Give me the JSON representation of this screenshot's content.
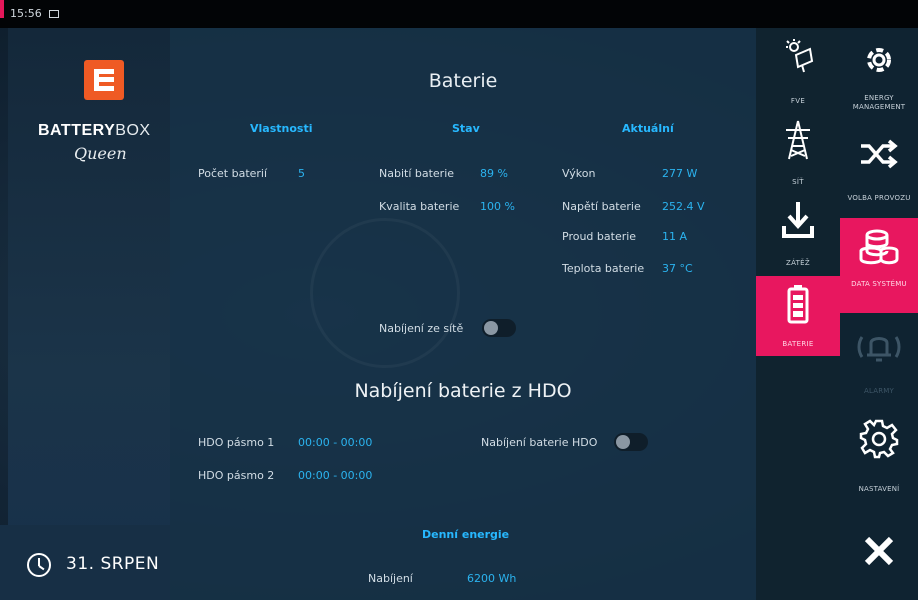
{
  "statusbar": {
    "time": "15:56"
  },
  "brand": {
    "name_bold": "BATTERY",
    "name_light": "BOX",
    "script": "Queen",
    "logo_color": "#ef5a24"
  },
  "datebar": {
    "date": "31. SRPEN"
  },
  "panel": {
    "title": "Baterie",
    "columns": {
      "props": "Vlastnosti",
      "state": "Stav",
      "current": "Aktuální"
    },
    "props": {
      "count_label": "Počet baterií",
      "count_value": "5"
    },
    "state": {
      "charged_label": "Nabití baterie",
      "charged_value": "89 %",
      "quality_label": "Kvalita baterie",
      "quality_value": "100 %"
    },
    "current": {
      "power_label": "Výkon",
      "power_value": "277 W",
      "voltage_label": "Napětí baterie",
      "voltage_value": "252.4 V",
      "current_label": "Proud baterie",
      "current_value": "11 A",
      "temp_label": "Teplota baterie",
      "temp_value": "37 °C"
    },
    "grid_charging_label": "Nabíjení ze sítě",
    "hdo_title": "Nabíjení baterie z HDO",
    "hdo1_label": "HDO pásmo 1",
    "hdo1_value": "00:00 - 00:00",
    "hdo2_label": "HDO pásmo 2",
    "hdo2_value": "00:00 - 00:00",
    "hdo_toggle_label": "Nabíjení baterie HDO",
    "daily_title": "Denní energie",
    "daily_charge_label": "Nabíjení",
    "daily_charge_value": "6200 Wh"
  },
  "devices": [
    {
      "label": "FVE",
      "icon": "solar-panel-icon"
    },
    {
      "label": "SÍŤ",
      "icon": "power-pylon-icon"
    },
    {
      "label": "ZÁTĚŽ",
      "icon": "download-icon"
    },
    {
      "label": "BATERIE",
      "icon": "battery-icon"
    }
  ],
  "menu": [
    {
      "label": "ENERGY MANAGEMENT",
      "icon": "energy-management-icon"
    },
    {
      "label": "VOLBA PROVOZU",
      "icon": "shuffle-icon"
    },
    {
      "label": "DATA SYSTÉMU",
      "icon": "database-icon"
    },
    {
      "label": "ALARMY",
      "icon": "bell-icon"
    },
    {
      "label": "NASTAVENÍ",
      "icon": "gear-icon"
    }
  ],
  "colors": {
    "accent": "#e8175f",
    "value_blue": "#2bb3ef",
    "header_blue": "#27b8ff"
  }
}
